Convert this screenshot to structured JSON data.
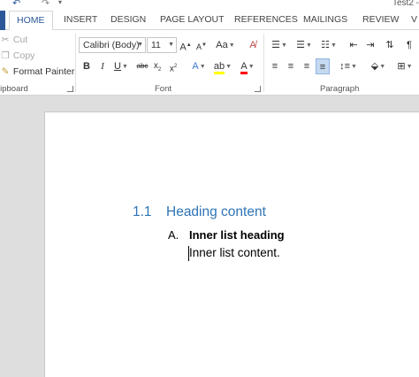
{
  "title_bar": {
    "doc_title": "Test2 -",
    "icons": [
      "undo-icon",
      "redo-icon",
      "customize-quick-access-icon"
    ]
  },
  "tabs": [
    {
      "label": "HOME",
      "active": true
    },
    {
      "label": "INSERT"
    },
    {
      "label": "DESIGN"
    },
    {
      "label": "PAGE LAYOUT"
    },
    {
      "label": "REFERENCES"
    },
    {
      "label": "MAILINGS"
    },
    {
      "label": "REVIEW"
    },
    {
      "label": "V"
    }
  ],
  "clipboard": {
    "cut": "Cut",
    "copy": "Copy",
    "format_painter": "Format Painter",
    "group_label": "lipboard"
  },
  "font": {
    "family": "Calibri (Body)",
    "size": "11",
    "group_label": "Font"
  },
  "paragraph": {
    "group_label": "Paragraph"
  },
  "colors": {
    "accent": "#2b579a",
    "heading": "#2e74b5",
    "highlight": "#ffff00",
    "font_color": "#ff0000"
  },
  "document": {
    "heading_number": "1.1",
    "heading_text": "Heading content",
    "list_marker": "A.",
    "list_heading": "Inner list heading",
    "list_content": "Inner list content."
  }
}
